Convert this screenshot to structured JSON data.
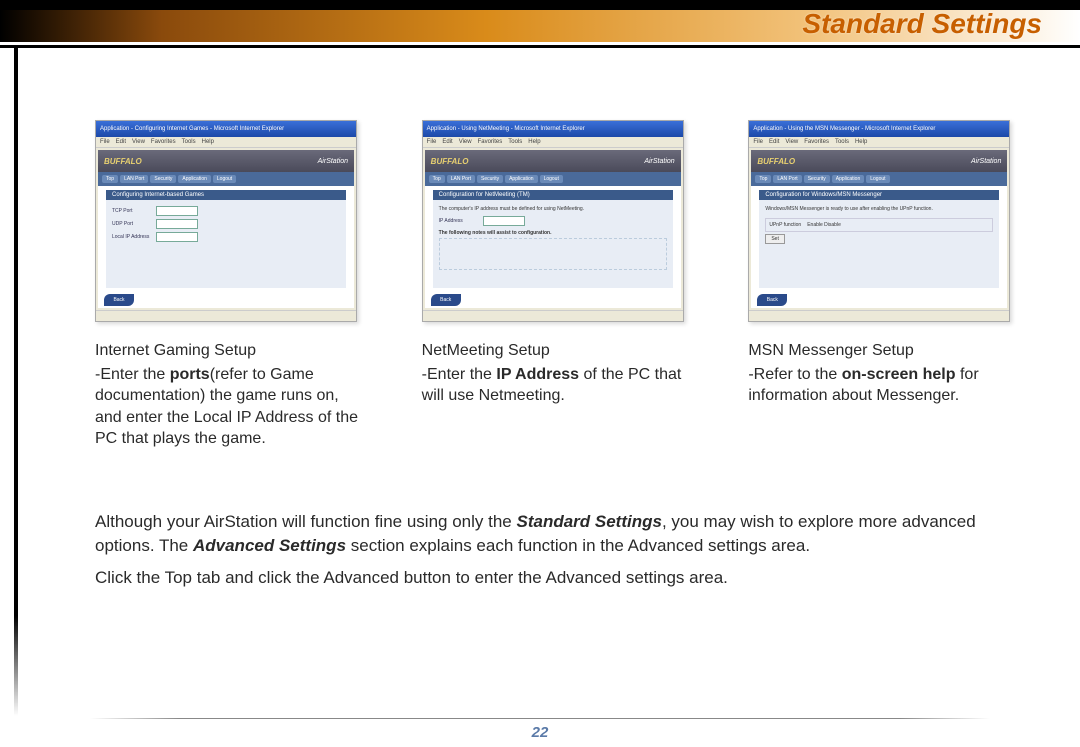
{
  "header": {
    "title": "Standard Settings"
  },
  "columns": [
    {
      "screenshot": {
        "brand": "BUFFALO",
        "product": "AirStation",
        "titlebar": "Application - Configuring Internet Games - Microsoft Internet Explorer",
        "section": "Configuring Internet-based Games",
        "fields": [
          "TCP Port",
          "UDP Port",
          "Local IP Address"
        ],
        "back": "Back"
      },
      "title": "Internet Gaming Setup",
      "desc_prefix": "-Enter the ",
      "desc_bold": "ports",
      "desc_suffix": "(refer to Game documentation) the game runs on, and enter the Local IP Address of the PC that plays the game."
    },
    {
      "screenshot": {
        "brand": "BUFFALO",
        "product": "AirStation",
        "titlebar": "Application - Using NetMeeting - Microsoft Internet Explorer",
        "section": "Configuration for NetMeeting (TM)",
        "body1": "The computer's IP address must be defined for using NetMeeting.",
        "field_label": "IP Address",
        "note": "The following notes will assist to configuration.",
        "back": "Back"
      },
      "title": "NetMeeting Setup",
      "desc_prefix": "-Enter the ",
      "desc_bold": "IP Address",
      "desc_suffix": " of the PC that will use Netmeeting."
    },
    {
      "screenshot": {
        "brand": "BUFFALO",
        "product": "AirStation",
        "titlebar": "Application - Using the MSN Messenger - Microsoft Internet Explorer",
        "section": "Configuration for Windows/MSN Messenger",
        "body1": "Windows/MSN Messenger is ready to use after enabling the UPnP function.",
        "toggle_label": "UPnP function",
        "toggle_opts": "Enable   Disable",
        "set": "Set",
        "back": "Back"
      },
      "title": "MSN Messenger Setup",
      "desc_prefix": "-Refer to the ",
      "desc_bold": "on-screen help",
      "desc_suffix": " for information about Messenger."
    }
  ],
  "paragraph": {
    "p1a": "Although your AirStation will function fine using only the ",
    "p1b": "Standard Settings",
    "p1c": ", you may wish to explore more advanced options.  The ",
    "p1d": "Advanced Settings",
    "p1e": " section explains each function in the Advanced settings area.",
    "p2": "Click the Top tab and click the Advanced button to enter the Advanced settings area."
  },
  "page_number": "22",
  "menus": [
    "File",
    "Edit",
    "View",
    "Favorites",
    "Tools",
    "Help"
  ],
  "tabs": [
    "Top",
    "LAN Port",
    "Security",
    "Application",
    "Logout"
  ]
}
